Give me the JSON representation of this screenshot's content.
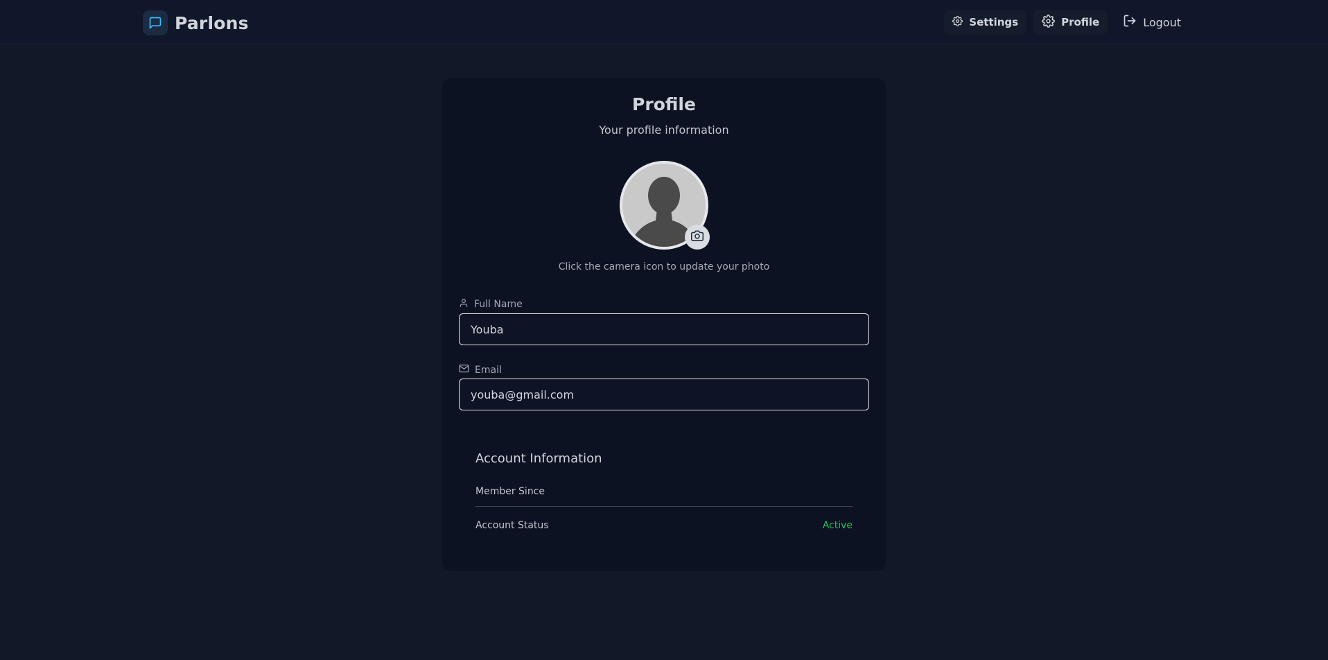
{
  "header": {
    "brand": "Parlons",
    "nav": {
      "settings": "Settings",
      "profile": "Profile",
      "logout": "Logout"
    }
  },
  "profile": {
    "title": "Profile",
    "subtitle": "Your profile information",
    "avatar_hint": "Click the camera icon to update your photo",
    "fields": {
      "full_name": {
        "label": "Full Name",
        "value": "Youba"
      },
      "email": {
        "label": "Email",
        "value": "youba@gmail.com"
      }
    },
    "account": {
      "title": "Account Information",
      "member_since_label": "Member Since",
      "member_since_value": "",
      "status_label": "Account Status",
      "status_value": "Active"
    }
  },
  "colors": {
    "background": "#111827",
    "card": "#0c1221",
    "accent": "#38bdf8",
    "status_active": "#22c55e"
  },
  "icons": [
    "message-square-icon",
    "gear-icon",
    "logout-icon",
    "camera-icon",
    "user-icon",
    "mail-icon"
  ]
}
